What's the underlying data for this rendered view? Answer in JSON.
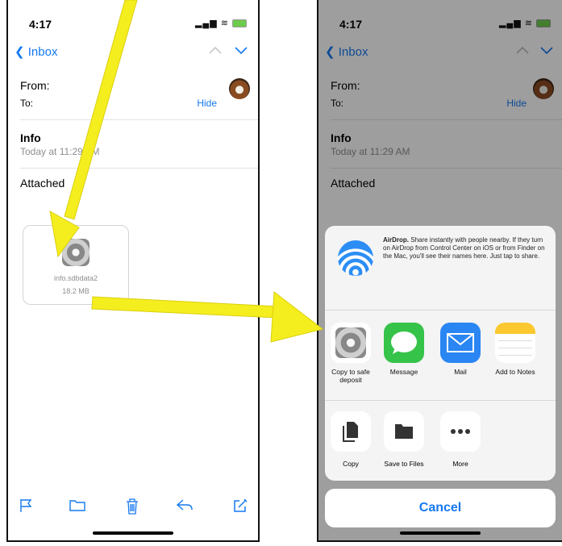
{
  "left_phone": {
    "status": {
      "time": "4:17"
    },
    "nav": {
      "back_label": "Inbox"
    },
    "header": {
      "from_label": "From:",
      "to_label": "To:",
      "hide_label": "Hide"
    },
    "message": {
      "subject": "Info",
      "date": "Today at 11:29 AM",
      "attached_label": "Attached"
    },
    "attachment": {
      "filename": "info.sdbdata2",
      "size": "18.2 MB"
    },
    "toolbar": [
      "flag-icon",
      "folder-icon",
      "trash-icon",
      "reply-icon",
      "compose-icon"
    ]
  },
  "right_phone": {
    "status": {
      "time": "4:17"
    },
    "nav": {
      "back_label": "Inbox"
    },
    "header": {
      "from_label": "From:",
      "to_label": "To:",
      "hide_label": "Hide"
    },
    "message": {
      "subject": "Info",
      "date": "Today at 11:29 AM",
      "attached_label": "Attached"
    },
    "share_sheet": {
      "airdrop_title": "AirDrop.",
      "airdrop_text": "Share instantly with people nearby. If they turn on AirDrop from Control Center on iOS or from Finder on the Mac, you'll see their names here. Just tap to share.",
      "apps": [
        {
          "label": "Copy to safe deposit",
          "icon": "safe-deposit-icon"
        },
        {
          "label": "Message",
          "icon": "messages-icon"
        },
        {
          "label": "Mail",
          "icon": "mail-icon"
        },
        {
          "label": "Add to Notes",
          "icon": "notes-icon"
        }
      ],
      "actions": [
        {
          "label": "Copy",
          "icon": "copy-icon"
        },
        {
          "label": "Save to Files",
          "icon": "files-icon"
        },
        {
          "label": "More",
          "icon": "more-icon"
        }
      ],
      "cancel_label": "Cancel"
    }
  },
  "colors": {
    "ios_blue": "#1478f0",
    "annotation_arrow": "#f5ee1e",
    "messages_green": "#36c34a",
    "mail_blue": "#2a86f3",
    "notes_yellow": "#fbc92f"
  }
}
